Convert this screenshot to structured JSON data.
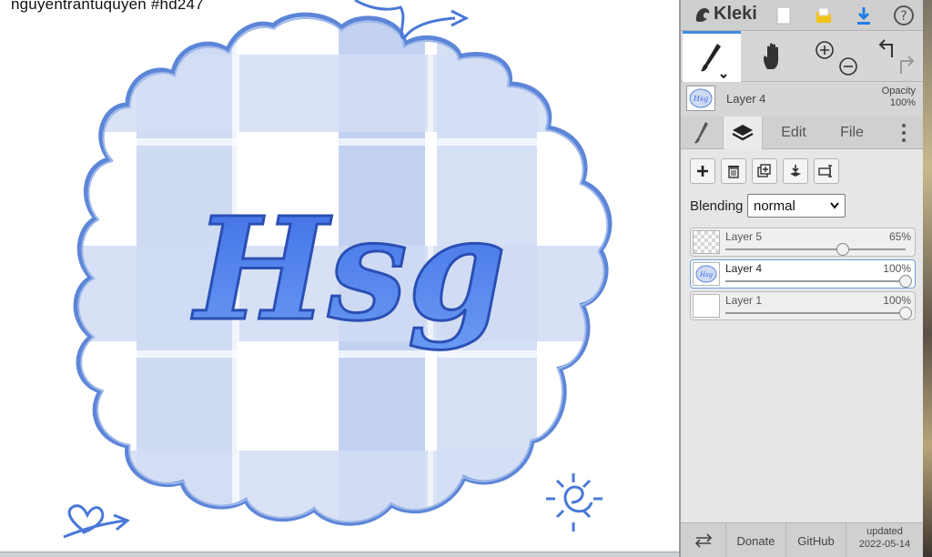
{
  "canvas": {
    "caption": "nguyentrantuquyen  #hd247",
    "artwork_text": "Hsg"
  },
  "header": {
    "app_name": "Kleki",
    "icons": [
      "kleki-logo-icon",
      "new-image-icon",
      "open-folder-icon",
      "download-icon",
      "help-icon"
    ]
  },
  "tools": {
    "items": [
      "brush-tool-icon",
      "hand-tool-icon",
      "zoom-in-icon",
      "zoom-out-icon",
      "undo-icon",
      "redo-icon"
    ]
  },
  "layer_preview": {
    "name": "Layer 4",
    "opacity_label": "Opacity",
    "opacity_value": "100%"
  },
  "tabs": {
    "edit": "Edit",
    "file": "File"
  },
  "layers_panel": {
    "buttons": [
      "add-layer-icon",
      "delete-layer-icon",
      "duplicate-layer-icon",
      "merge-down-icon",
      "rename-layer-icon"
    ],
    "blending_label": "Blending",
    "blending_value": "normal",
    "layers": [
      {
        "name": "Layer 5",
        "opacity": "65%",
        "level": 0.65,
        "active": false
      },
      {
        "name": "Layer 4",
        "opacity": "100%",
        "level": 1.0,
        "active": true
      },
      {
        "name": "Layer 1",
        "opacity": "100%",
        "level": 1.0,
        "active": false
      }
    ]
  },
  "footer": {
    "donate": "Donate",
    "github": "GitHub",
    "updated_label": "updated",
    "updated_date": "2022-05-14"
  },
  "colors": {
    "accent": "#3d8be0",
    "art_blue": "#4a78d8",
    "art_light": "#c9d6f2",
    "panel_bg": "#dcdcdc"
  }
}
